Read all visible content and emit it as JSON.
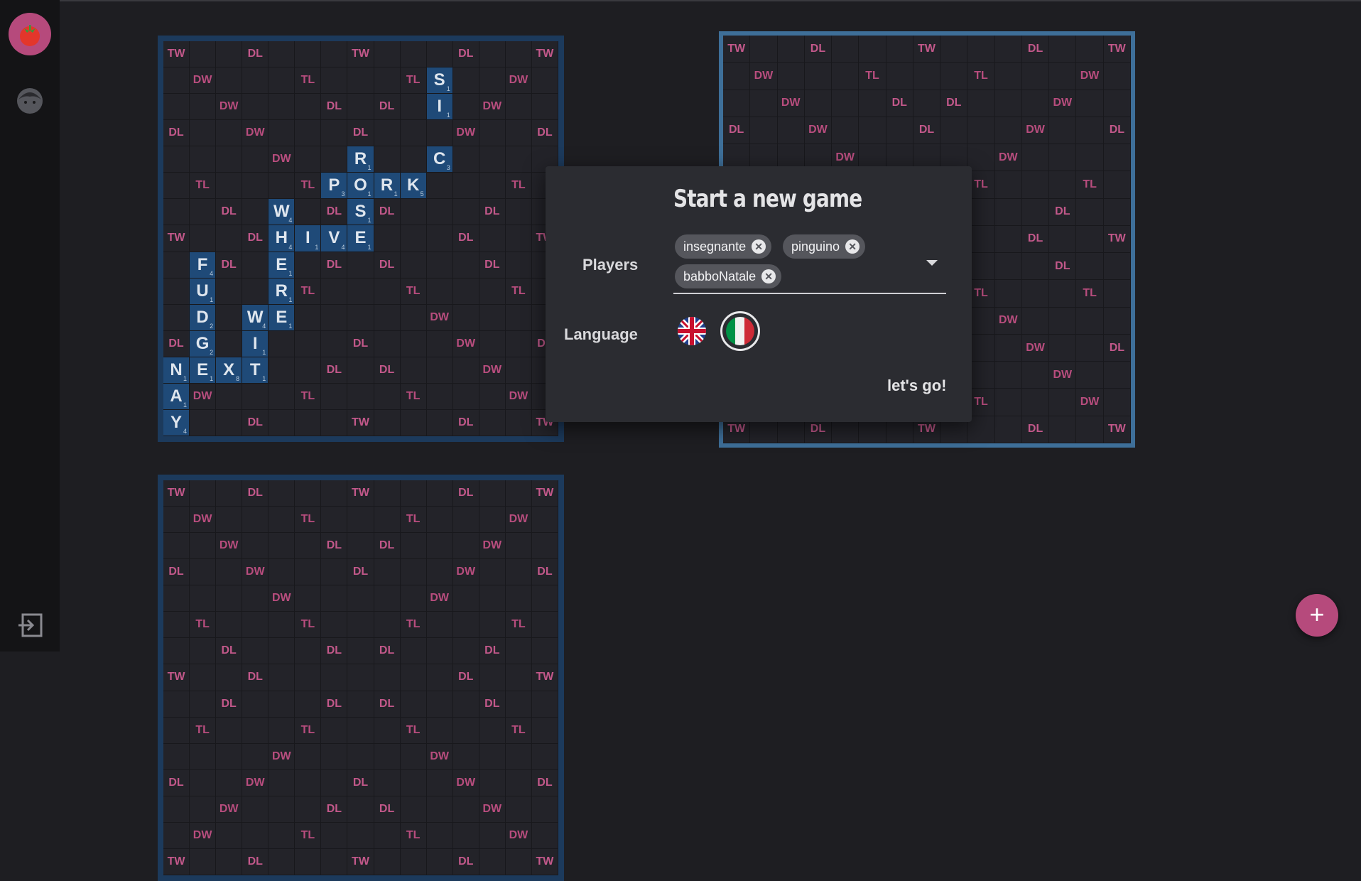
{
  "app": {
    "logo": "tomato-icon"
  },
  "sidebar": {
    "profile_icon": "user-avatar-icon",
    "logout_icon": "logout-icon"
  },
  "colors": {
    "accent": "#b64a7c",
    "board_border": "#1c3a5c",
    "board_border_selected": "#3e6f99",
    "tile": "#1f4a78",
    "premium": "#c2588a"
  },
  "boards": [
    {
      "id": "board-1",
      "tiles": [
        {
          "r": 1,
          "c": 10,
          "l": "S",
          "p": "1"
        },
        {
          "r": 2,
          "c": 10,
          "l": "I",
          "p": "1"
        },
        {
          "r": 4,
          "c": 10,
          "l": "C",
          "p": "3"
        },
        {
          "r": 4,
          "c": 7,
          "l": "R",
          "p": "1"
        },
        {
          "r": 5,
          "c": 6,
          "l": "P",
          "p": "3"
        },
        {
          "r": 5,
          "c": 7,
          "l": "O",
          "p": "1"
        },
        {
          "r": 5,
          "c": 8,
          "l": "R",
          "p": "1"
        },
        {
          "r": 5,
          "c": 9,
          "l": "K",
          "p": "5"
        },
        {
          "r": 6,
          "c": 7,
          "l": "S",
          "p": "1"
        },
        {
          "r": 6,
          "c": 4,
          "l": "W",
          "p": "4"
        },
        {
          "r": 7,
          "c": 4,
          "l": "H",
          "p": "4"
        },
        {
          "r": 7,
          "c": 5,
          "l": "I",
          "p": "1"
        },
        {
          "r": 7,
          "c": 6,
          "l": "V",
          "p": "4"
        },
        {
          "r": 7,
          "c": 7,
          "l": "E",
          "p": "1"
        },
        {
          "r": 8,
          "c": 4,
          "l": "E",
          "p": "1"
        },
        {
          "r": 9,
          "c": 4,
          "l": "R",
          "p": "1"
        },
        {
          "r": 10,
          "c": 4,
          "l": "E",
          "p": "1"
        },
        {
          "r": 10,
          "c": 3,
          "l": "W",
          "p": "4"
        },
        {
          "r": 11,
          "c": 3,
          "l": "I",
          "p": "1"
        },
        {
          "r": 12,
          "c": 3,
          "l": "T",
          "p": "1"
        },
        {
          "r": 8,
          "c": 1,
          "l": "F",
          "p": "4"
        },
        {
          "r": 9,
          "c": 1,
          "l": "U",
          "p": "1"
        },
        {
          "r": 10,
          "c": 1,
          "l": "D",
          "p": "2"
        },
        {
          "r": 11,
          "c": 1,
          "l": "G",
          "p": "2"
        },
        {
          "r": 12,
          "c": 1,
          "l": "E",
          "p": "1"
        },
        {
          "r": 12,
          "c": 2,
          "l": "X",
          "p": "8"
        },
        {
          "r": 12,
          "c": 0,
          "l": "N",
          "p": "1"
        },
        {
          "r": 13,
          "c": 0,
          "l": "A",
          "p": "1"
        },
        {
          "r": 14,
          "c": 0,
          "l": "Y",
          "p": "4"
        }
      ]
    },
    {
      "id": "board-2",
      "tiles": []
    },
    {
      "id": "board-3",
      "tiles": []
    }
  ],
  "premium_layout": [
    [
      "TW",
      "",
      "",
      "DL",
      "",
      "",
      "",
      "TW",
      "",
      "",
      "",
      "DL",
      "",
      "",
      "TW"
    ],
    [
      "",
      "DW",
      "",
      "",
      "",
      "TL",
      "",
      "",
      "",
      "TL",
      "",
      "",
      "",
      "DW",
      ""
    ],
    [
      "",
      "",
      "DW",
      "",
      "",
      "",
      "DL",
      "",
      "DL",
      "",
      "",
      "",
      "DW",
      "",
      ""
    ],
    [
      "DL",
      "",
      "",
      "DW",
      "",
      "",
      "",
      "DL",
      "",
      "",
      "",
      "DW",
      "",
      "",
      "DL"
    ],
    [
      "",
      "",
      "",
      "",
      "DW",
      "",
      "",
      "",
      "",
      "",
      "DW",
      "",
      "",
      "",
      ""
    ],
    [
      "",
      "TL",
      "",
      "",
      "",
      "TL",
      "",
      "",
      "",
      "TL",
      "",
      "",
      "",
      "TL",
      ""
    ],
    [
      "",
      "",
      "DL",
      "",
      "",
      "",
      "DL",
      "",
      "DL",
      "",
      "",
      "",
      "DL",
      "",
      ""
    ],
    [
      "TW",
      "",
      "",
      "DL",
      "",
      "",
      "",
      "",
      "",
      "",
      "",
      "DL",
      "",
      "",
      "TW"
    ],
    [
      "",
      "",
      "DL",
      "",
      "",
      "",
      "DL",
      "",
      "DL",
      "",
      "",
      "",
      "DL",
      "",
      ""
    ],
    [
      "",
      "TL",
      "",
      "",
      "",
      "TL",
      "",
      "",
      "",
      "TL",
      "",
      "",
      "",
      "TL",
      ""
    ],
    [
      "",
      "",
      "",
      "",
      "DW",
      "",
      "",
      "",
      "",
      "",
      "DW",
      "",
      "",
      "",
      ""
    ],
    [
      "DL",
      "",
      "",
      "DW",
      "",
      "",
      "",
      "DL",
      "",
      "",
      "",
      "DW",
      "",
      "",
      "DL"
    ],
    [
      "",
      "",
      "DW",
      "",
      "",
      "",
      "DL",
      "",
      "DL",
      "",
      "",
      "",
      "DW",
      "",
      ""
    ],
    [
      "",
      "DW",
      "",
      "",
      "",
      "TL",
      "",
      "",
      "",
      "TL",
      "",
      "",
      "",
      "DW",
      ""
    ],
    [
      "TW",
      "",
      "",
      "DL",
      "",
      "",
      "",
      "TW",
      "",
      "",
      "",
      "DL",
      "",
      "",
      "TW"
    ]
  ],
  "modal": {
    "title": "Start a new game",
    "players_label": "Players",
    "players": [
      "insegnante",
      "pinguino",
      "babboNatale"
    ],
    "language_label": "Language",
    "languages": [
      "english-flag-icon",
      "italian-flag-icon"
    ],
    "selected_language": "italian",
    "submit_label": "let's go!"
  },
  "fab": {
    "label": "+"
  }
}
